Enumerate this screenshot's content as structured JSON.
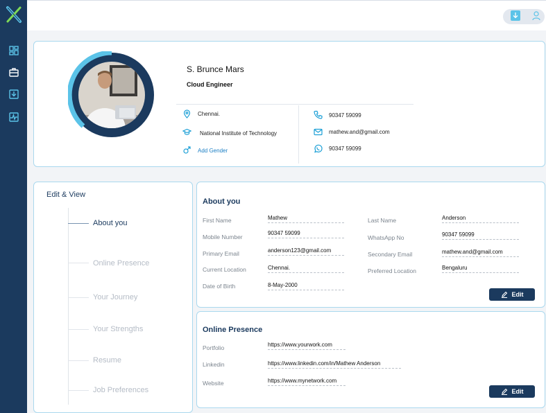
{
  "brand": {
    "logo_icon": "x-logo-icon",
    "accent": "#5bc3e8",
    "navy": "#1b3a5e"
  },
  "sidebar": {
    "items": [
      {
        "icon": "dashboard-icon"
      },
      {
        "icon": "briefcase-icon"
      },
      {
        "icon": "download-box-icon"
      },
      {
        "icon": "activity-icon"
      }
    ]
  },
  "topbar": {
    "actions": [
      {
        "icon": "download-icon"
      },
      {
        "icon": "user-icon"
      }
    ]
  },
  "profile": {
    "name": "S. Brunce Mars",
    "role": "Cloud Engineer",
    "location": "Chennai.",
    "institute": "National Institute of Technology",
    "add_gender": "Add Gender",
    "phone": "90347 59099",
    "email": "mathew.and@gmail.com",
    "whatsapp": "90347 59099"
  },
  "edit_view": {
    "title": "Edit & View",
    "items": [
      "About you",
      "Online Presence",
      "Your Journey",
      "Your Strengths",
      "Resume",
      "Job Preferences"
    ],
    "active_index": 0
  },
  "about": {
    "title": "About you",
    "first_name_label": "First Name",
    "first_name": "Mathew",
    "last_name_label": "Last Name",
    "last_name": "Anderson",
    "mobile_label": "Mobile Number",
    "mobile": "90347 59099",
    "whatsapp_label": "WhatsApp No",
    "whatsapp": "90347 59099",
    "primary_email_label": "Primary Email",
    "primary_email": "anderson123@gmail.com",
    "secondary_email_label": "Secondary Email",
    "secondary_email": "mathew.and@gmail.com",
    "current_location_label": "Current Location",
    "current_location": "Chennai.",
    "preferred_location_label": "Preferred Location",
    "preferred_location": "Bengaluru",
    "dob_label": "Date of Birth",
    "dob": "8-May-2000",
    "edit_label": "Edit"
  },
  "online": {
    "title": "Online Presence",
    "portfolio_label": "Portfolio",
    "portfolio": "https://www.yourwork.com",
    "linkedin_label": "Linkedin",
    "linkedin": "https://www.linkedin.com/in/Mathew Anderson",
    "website_label": "Website",
    "website": "https://www.mynetwork.com",
    "edit_label": "Edit"
  }
}
